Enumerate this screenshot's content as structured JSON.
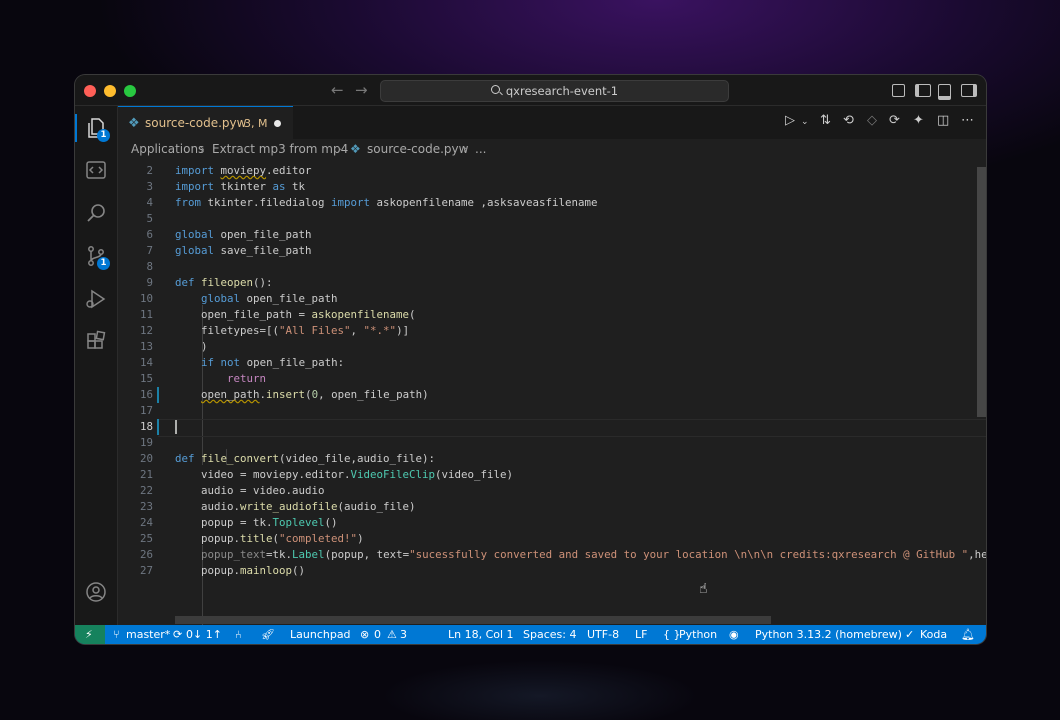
{
  "window": {
    "search_text": "qxresearch-event-1",
    "colors": {
      "accent": "#0078d4",
      "status_bar": "#0078d4",
      "remote": "#16825d",
      "modified": "#e2c08d"
    }
  },
  "activity_bar": {
    "items": [
      {
        "name": "explorer-icon",
        "badge": "1"
      },
      {
        "name": "remote-explorer-icon",
        "badge": ""
      },
      {
        "name": "search-icon",
        "badge": ""
      },
      {
        "name": "source-control-icon",
        "badge": "1"
      },
      {
        "name": "run-debug-icon",
        "badge": ""
      },
      {
        "name": "extensions-icon",
        "badge": ""
      }
    ],
    "bottom": [
      {
        "name": "account-icon"
      },
      {
        "name": "settings-gear-icon"
      }
    ]
  },
  "tab": {
    "label": "source-code.pyw",
    "meta": "3, M"
  },
  "breadcrumbs": [
    "Applications",
    "Extract mp3 from mp4",
    "source-code.pyw",
    "..."
  ],
  "editor": {
    "current_line": "18",
    "lines": [
      {
        "n": "2",
        "text": "import moviepy.editor"
      },
      {
        "n": "3",
        "text": "import tkinter as tk"
      },
      {
        "n": "4",
        "text": "from tkinter.filedialog import askopenfilename ,asksaveasfilename"
      },
      {
        "n": "5",
        "text": ""
      },
      {
        "n": "6",
        "text": "global open_file_path"
      },
      {
        "n": "7",
        "text": "global save_file_path"
      },
      {
        "n": "8",
        "text": ""
      },
      {
        "n": "9",
        "text": "def fileopen():"
      },
      {
        "n": "10",
        "text": "    global open_file_path"
      },
      {
        "n": "11",
        "text": "    open_file_path = askopenfilename("
      },
      {
        "n": "12",
        "text": "    filetypes=[(\"All Files\", \"*.*\")]"
      },
      {
        "n": "13",
        "text": "    )"
      },
      {
        "n": "14",
        "text": "    if not open_file_path:"
      },
      {
        "n": "15",
        "text": "        return"
      },
      {
        "n": "16",
        "text": "    open_path.insert(0, open_file_path)"
      },
      {
        "n": "17",
        "text": ""
      },
      {
        "n": "18",
        "text": ""
      },
      {
        "n": "19",
        "text": ""
      },
      {
        "n": "20",
        "text": "def file_convert(video_file,audio_file):"
      },
      {
        "n": "21",
        "text": "    video = moviepy.editor.VideoFileClip(video_file)"
      },
      {
        "n": "22",
        "text": "    audio = video.audio"
      },
      {
        "n": "23",
        "text": "    audio.write_audiofile(audio_file)"
      },
      {
        "n": "24",
        "text": "    popup = tk.Toplevel()"
      },
      {
        "n": "25",
        "text": "    popup.title(\"completed!\")"
      },
      {
        "n": "26",
        "text": "    popup_text=tk.Label(popup, text=\"sucessfully converted and saved to your location \\n\\n\\n credits:qxresearch @ GitHub \",hei"
      },
      {
        "n": "27",
        "text": "    popup.mainloop()"
      }
    ]
  },
  "status_bar": {
    "branch": "master*",
    "sync": "0↓ 1↑",
    "launchpad": "Launchpad",
    "errors": "0",
    "warnings": "3",
    "position": "Ln 18, Col 1",
    "spaces": "Spaces: 4",
    "encoding": "UTF-8",
    "eol": "LF",
    "language": "Python",
    "interpreter": "Python 3.13.2 (homebrew)",
    "koda": "Koda"
  }
}
